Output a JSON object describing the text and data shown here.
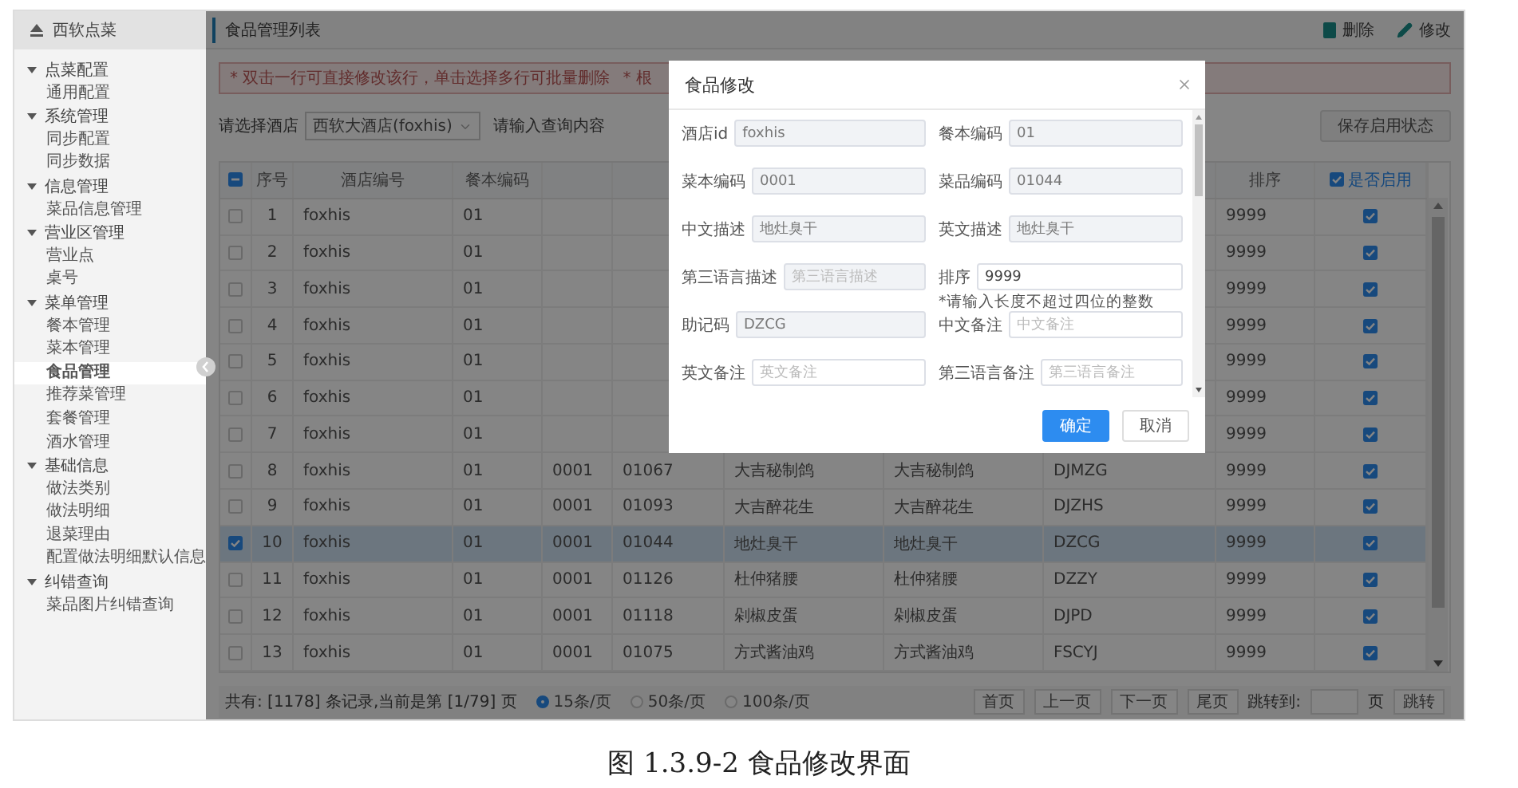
{
  "sidebar": {
    "title": "西软点菜",
    "groups": [
      {
        "label": "点菜配置",
        "expanded": true,
        "children": [
          {
            "label": "通用配置",
            "selected": false
          }
        ]
      },
      {
        "label": "系统管理",
        "expanded": true,
        "children": [
          {
            "label": "同步配置",
            "selected": false
          },
          {
            "label": "同步数据",
            "selected": false
          }
        ]
      },
      {
        "label": "信息管理",
        "expanded": true,
        "children": [
          {
            "label": "菜品信息管理",
            "selected": false
          }
        ]
      },
      {
        "label": "营业区管理",
        "expanded": true,
        "children": [
          {
            "label": "营业点",
            "selected": false
          },
          {
            "label": "桌号",
            "selected": false
          }
        ]
      },
      {
        "label": "菜单管理",
        "expanded": true,
        "children": [
          {
            "label": "餐本管理",
            "selected": false
          },
          {
            "label": "菜本管理",
            "selected": false
          },
          {
            "label": "食品管理",
            "selected": true
          },
          {
            "label": "推荐菜管理",
            "selected": false
          },
          {
            "label": "套餐管理",
            "selected": false
          },
          {
            "label": "酒水管理",
            "selected": false
          }
        ]
      },
      {
        "label": "基础信息",
        "expanded": true,
        "children": [
          {
            "label": "做法类别",
            "selected": false
          },
          {
            "label": "做法明细",
            "selected": false
          },
          {
            "label": "退菜理由",
            "selected": false
          },
          {
            "label": "配置做法明细默认信息",
            "selected": false
          }
        ]
      },
      {
        "label": "纠错查询",
        "expanded": true,
        "children": [
          {
            "label": "菜品图片纠错查询",
            "selected": false
          }
        ]
      }
    ]
  },
  "header": {
    "title": "食品管理列表",
    "actions": [
      {
        "label": "删除",
        "kind": "delete"
      },
      {
        "label": "修改",
        "kind": "edit"
      }
    ]
  },
  "notice": [
    "* 双击一行可直接修改该行，单击选择多行可批量删除",
    "* 根"
  ],
  "filter": {
    "hotel_label": "请选择酒店",
    "hotel_value": "西软大酒店(foxhis)",
    "query_label": "请输入查询内容",
    "save_button": {
      "label": "保存启用状态",
      "disabled": true
    }
  },
  "table": {
    "select_all_indeterminate": true,
    "columns": [
      "序号",
      "酒店编号",
      "餐本编码",
      "排序"
    ],
    "enabled_column": {
      "label": "是否启用",
      "checked": true
    },
    "rows": [
      {
        "checked": false,
        "selected": false,
        "index": "1",
        "hotel": "foxhis",
        "menu": "01",
        "sort": "9999",
        "enabled": true
      },
      {
        "checked": false,
        "selected": false,
        "index": "2",
        "hotel": "foxhis",
        "menu": "01",
        "sort": "9999",
        "enabled": true
      },
      {
        "checked": false,
        "selected": false,
        "index": "3",
        "hotel": "foxhis",
        "menu": "01",
        "sort": "9999",
        "enabled": true
      },
      {
        "checked": false,
        "selected": false,
        "index": "4",
        "hotel": "foxhis",
        "menu": "01",
        "sort": "9999",
        "enabled": true
      },
      {
        "checked": false,
        "selected": false,
        "index": "5",
        "hotel": "foxhis",
        "menu": "01",
        "sort": "9999",
        "enabled": true
      },
      {
        "checked": false,
        "selected": false,
        "index": "6",
        "hotel": "foxhis",
        "menu": "01",
        "sort": "9999",
        "enabled": true
      },
      {
        "checked": false,
        "selected": false,
        "index": "7",
        "hotel": "foxhis",
        "menu": "01",
        "sort": "9999",
        "enabled": true
      },
      {
        "checked": false,
        "selected": false,
        "index": "8",
        "hotel": "foxhis",
        "menu": "01",
        "column_5": "0001",
        "column_6": "01067",
        "column_7": "大吉秘制鸽",
        "column_8": "大吉秘制鸽",
        "column_9": "DJMZG",
        "sort": "9999",
        "enabled": true
      },
      {
        "checked": false,
        "selected": false,
        "index": "9",
        "hotel": "foxhis",
        "menu": "01",
        "column_5": "0001",
        "column_6": "01093",
        "column_7": "大吉醉花生",
        "column_8": "大吉醉花生",
        "column_9": "DJZHS",
        "sort": "9999",
        "enabled": true
      },
      {
        "checked": true,
        "selected": true,
        "index": "10",
        "hotel": "foxhis",
        "menu": "01",
        "column_5": "0001",
        "column_6": "01044",
        "column_7": "地灶臭干",
        "column_8": "地灶臭干",
        "column_9": "DZCG",
        "sort": "9999",
        "enabled": true
      },
      {
        "checked": false,
        "selected": false,
        "index": "11",
        "hotel": "foxhis",
        "menu": "01",
        "column_5": "0001",
        "column_6": "01126",
        "column_7": "杜仲猪腰",
        "column_8": "杜仲猪腰",
        "column_9": "DZZY",
        "sort": "9999",
        "enabled": true
      },
      {
        "checked": false,
        "selected": false,
        "index": "12",
        "hotel": "foxhis",
        "menu": "01",
        "column_5": "0001",
        "column_6": "01118",
        "column_7": "剁椒皮蛋",
        "column_8": "剁椒皮蛋",
        "column_9": "DJPD",
        "sort": "9999",
        "enabled": true
      },
      {
        "checked": false,
        "selected": false,
        "index": "13",
        "hotel": "foxhis",
        "menu": "01",
        "column_5": "0001",
        "column_6": "01075",
        "column_7": "方式酱油鸡",
        "column_8": "方式酱油鸡",
        "column_9": "FSCYJ",
        "sort": "9999",
        "enabled": true
      }
    ]
  },
  "footer": {
    "summary": "共有: [1178] 条记录,当前是第 [1/79] 页",
    "page_sizes": [
      {
        "label": "15条/页",
        "selected": true
      },
      {
        "label": "50条/页",
        "selected": false
      },
      {
        "label": "100条/页",
        "selected": false
      }
    ],
    "nav": [
      "首页",
      "上一页",
      "下一页",
      "尾页"
    ],
    "jump_label": "跳转到:",
    "page_unit": "页",
    "jump_button": "跳转"
  },
  "modal": {
    "title": "食品修改",
    "fields": [
      {
        "label": "酒店id",
        "value": "foxhis",
        "disabled": true
      },
      {
        "label": "餐本编码",
        "value": "01",
        "disabled": true
      },
      {
        "label": "菜本编码",
        "value": "0001",
        "disabled": true
      },
      {
        "label": "菜品编码",
        "value": "01044",
        "disabled": true
      },
      {
        "label": "中文描述",
        "value": "地灶臭干",
        "disabled": true
      },
      {
        "label": "英文描述",
        "value": "地灶臭干",
        "disabled": true
      },
      {
        "label": "第三语言描述",
        "placeholder": "第三语言描述",
        "disabled": true
      },
      {
        "label": "排序",
        "value": "9999",
        "disabled": false,
        "hint": "*请输入长度不超过四位的整数"
      },
      {
        "label": "助记码",
        "value": "DZCG",
        "disabled": true
      },
      {
        "label": "中文备注",
        "placeholder": "中文备注",
        "disabled": false
      },
      {
        "label": "英文备注",
        "placeholder": "英文备注",
        "disabled": false
      },
      {
        "label": "第三语言备注",
        "placeholder": "第三语言备注",
        "disabled": false
      }
    ],
    "buttons": [
      {
        "label": "确定",
        "kind": "primary"
      },
      {
        "label": "取消",
        "kind": "default"
      }
    ]
  },
  "caption": "图 1.3.9-2 食品修改界面"
}
